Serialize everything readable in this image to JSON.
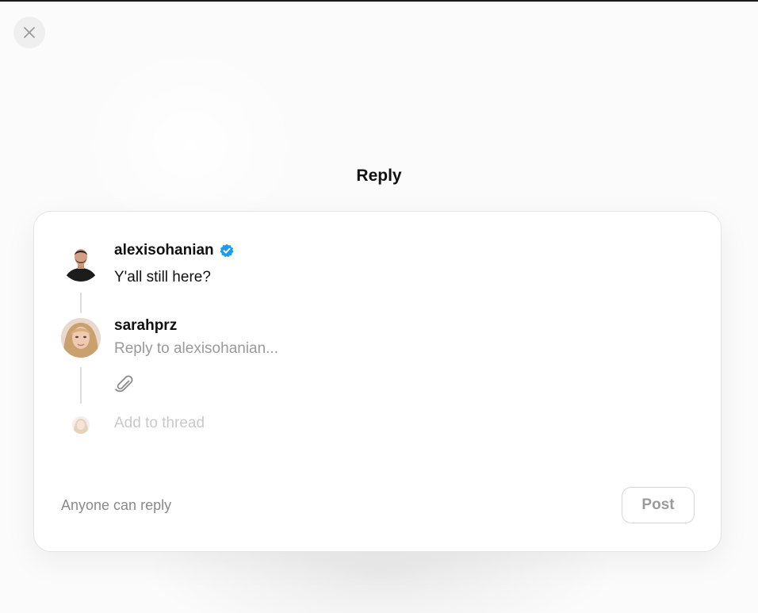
{
  "dialog": {
    "title": "Reply"
  },
  "original_post": {
    "username": "alexisohanian",
    "verified": true,
    "text": "Y'all still here?"
  },
  "reply": {
    "username": "sarahprz",
    "placeholder": "Reply to alexisohanian...",
    "value": "",
    "add_to_thread_label": "Add to thread"
  },
  "footer": {
    "reply_permission_label": "Anyone can reply",
    "post_label": "Post"
  },
  "icons": {
    "close": "close-icon",
    "verified": "verified-badge-icon",
    "attach": "paperclip-icon"
  },
  "colors": {
    "verified_badge": "#1d9bf0",
    "muted_text": "#8a8a8a",
    "placeholder_text": "#9a9a9a",
    "disabled_button_text": "#9b9b9b"
  }
}
